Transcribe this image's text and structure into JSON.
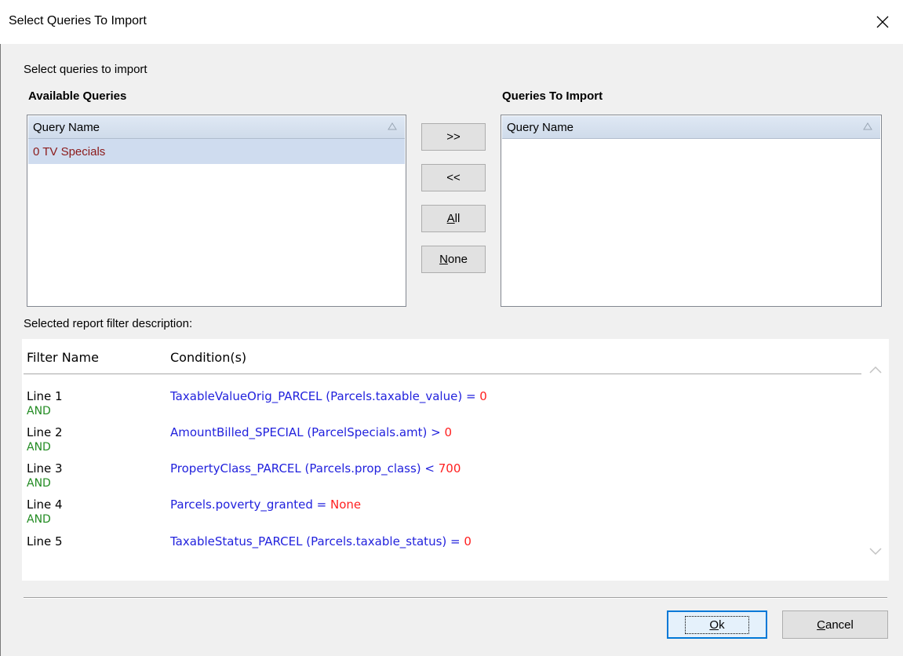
{
  "window": {
    "title": "Select Queries To Import"
  },
  "instructions": "Select queries to import",
  "available": {
    "heading": "Available Queries",
    "column": "Query Name",
    "items": [
      "0 TV Specials"
    ]
  },
  "import": {
    "heading": "Queries To Import",
    "column": "Query Name",
    "items": []
  },
  "transfer_buttons": {
    "add": ">>",
    "remove": "<<",
    "all_label": "All",
    "all_mnemonic": "A",
    "all_rest": "ll",
    "none_label": "None",
    "none_mnemonic": "N",
    "none_rest": "one"
  },
  "filter": {
    "label": "Selected report filter description:",
    "col_name": "Filter Name",
    "col_conditions": "Condition(s)",
    "lines": [
      {
        "name": "Line 1",
        "condition": "TaxableValueOrig_PARCEL (Parcels.taxable_value) = ",
        "value": "0"
      },
      {
        "name": "Line 2",
        "condition": "AmountBilled_SPECIAL (ParcelSpecials.amt) > ",
        "value": "0"
      },
      {
        "name": "Line 3",
        "condition": "PropertyClass_PARCEL (Parcels.prop_class) < ",
        "value": "700"
      },
      {
        "name": "Line 4",
        "condition": "Parcels.poverty_granted = ",
        "value": "None"
      },
      {
        "name": "Line 5",
        "condition": "TaxableStatus_PARCEL (Parcels.taxable_status) = ",
        "value": "0"
      }
    ],
    "connector": "AND"
  },
  "buttons": {
    "ok_mnemonic": "O",
    "ok_rest": "k",
    "cancel_mnemonic": "C",
    "cancel_rest": "ancel"
  },
  "colors": {
    "condition_text": "#2222dd",
    "condition_value": "#ff2020",
    "connector": "#228b22",
    "selected_row_text": "#8b1a1a"
  },
  "icons": {
    "close": "close-icon",
    "sort": "sort-ascending-icon",
    "scroll_up": "chevron-up-icon",
    "scroll_down": "chevron-down-icon"
  }
}
